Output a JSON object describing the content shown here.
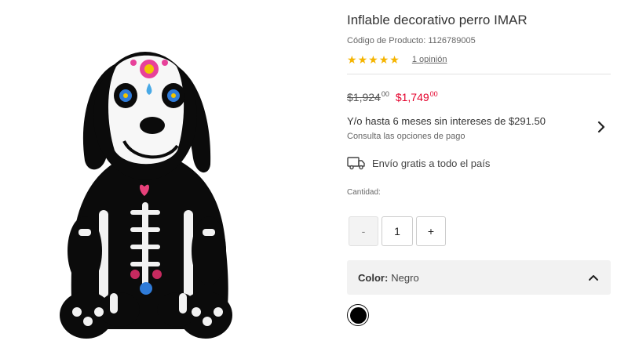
{
  "product": {
    "title": "Inflable decorativo perro IMAR",
    "code": "Código de Producto: 1126789005",
    "rating": {
      "stars": 5,
      "reviews_label": "1 opinión"
    }
  },
  "pricing": {
    "old_price": "$1,924",
    "old_cents": "00",
    "new_price": "$1,749",
    "new_cents": "00",
    "installments": "Y/o hasta 6 meses sin intereses de $291.50",
    "payment_link": "Consulta las opciones de pago"
  },
  "shipping": {
    "text": "Envío gratis a todo el país",
    "icon": "truck-icon"
  },
  "quantity": {
    "label": "Cantidad:",
    "minus": "-",
    "value": "1",
    "plus": "+"
  },
  "color": {
    "label": "Color:",
    "value": "Negro",
    "swatches": [
      {
        "name": "Negro",
        "hex": "#000000",
        "selected": true
      }
    ]
  },
  "colors": {
    "accent_price": "#e4002b",
    "star": "#f5b400"
  }
}
